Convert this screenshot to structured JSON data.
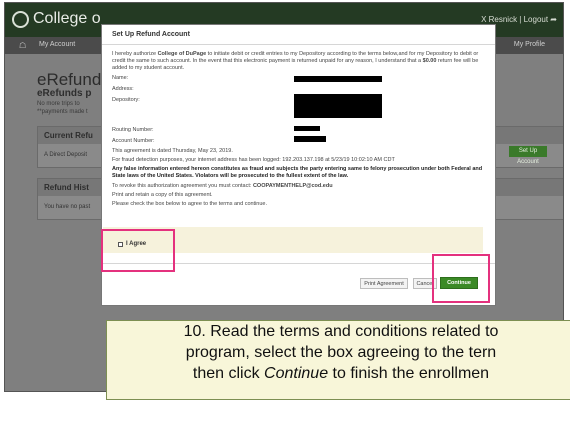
{
  "app": {
    "logo_text": "College o",
    "user_links": "X Resnick | Logout ➦"
  },
  "nav": {
    "my_account": "My Account",
    "my_profile": "My Profile"
  },
  "background": {
    "title": "eRefund",
    "subtitle": "eRefunds p",
    "note1": "No more trips to",
    "note2": "**payments made t",
    "current_panel_title": "Current Refu",
    "current_panel_body": "A Direct Deposit",
    "setup_button": "Set Up Account",
    "history_panel_title": "Refund Hist",
    "history_panel_body": "You have no past"
  },
  "modal": {
    "title": "Set Up Refund Account",
    "intro_pre": "I hereby authorize ",
    "intro_org": "College of DuPage",
    "intro_mid": " to initiate debit or credit entries to my Depository according to the terms below,and for my Depository to debit or credit the same to such account. In the event that this electronic payment is returned unpaid for any reason, I understand that a ",
    "intro_fee": "$0.00",
    "intro_post": " return fee will be added to my student account.",
    "name_label": "Name:",
    "address_label": "Address:",
    "depository_label": "Depository:",
    "routing_label": "Routing Number:",
    "account_label": "Account Number:",
    "dated": "This agreement is dated Thursday, May 23, 2019.",
    "fraud_ip": "For fraud detection purposes, your internet address has been logged: 192.203.137.198 at 5/23/19 10:02:10 AM CDT",
    "warning": "Any false information entered hereon constitutes as fraud and subjects the party entering same to felony prosecution under both Federal and State laws of the United States. Violators will be prosecuted to the fullest extent of the law.",
    "revoke_pre": "To revoke this authorization agreement you must contact: ",
    "revoke_email": "COOPAYMENTHELP@cod.edu",
    "print_line": "Print and retain a copy of this agreement.",
    "check_line": "Please check the box below to agree to the terms and continue.",
    "agree_label": "I Agree",
    "print_button": "Print Agreement",
    "cancel_button": "Cancel",
    "continue_button": "Continue"
  },
  "caption": {
    "line1": "10. Read the terms and conditions related to",
    "line2": "program, select the box agreeing to the tern",
    "line3_pre": "then click ",
    "line3_em": "Continue",
    "line3_post": " to finish the enrollmen"
  },
  "colors": {
    "highlight": "#e4317e",
    "continue_green": "#3b8a26",
    "caption_bg": "#f8f6d9"
  }
}
